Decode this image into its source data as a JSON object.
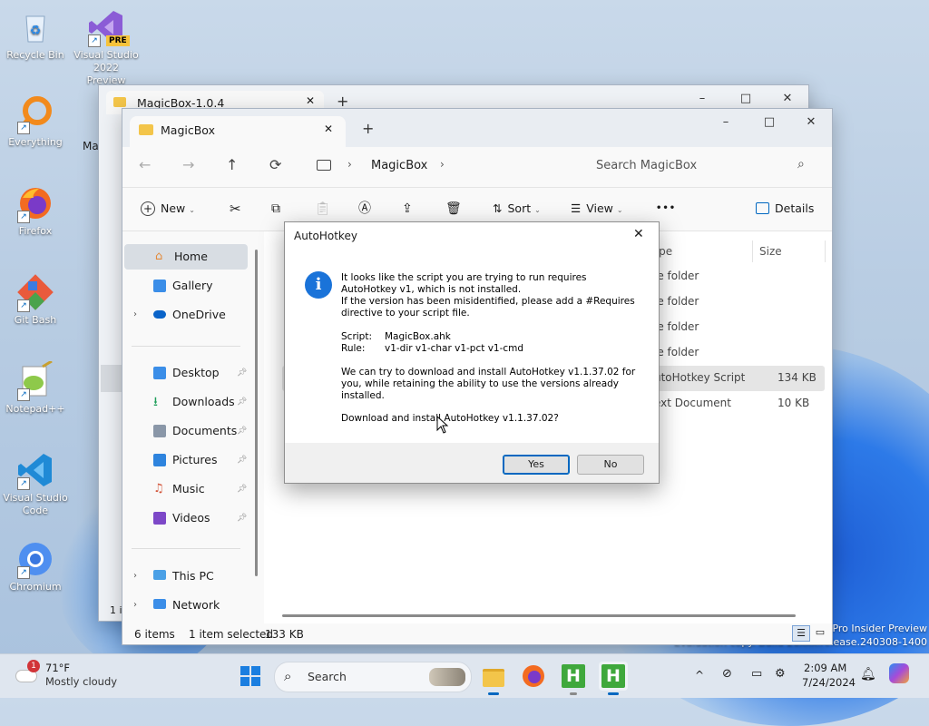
{
  "desktop": {
    "icons": [
      {
        "label": "Recycle Bin"
      },
      {
        "label": "Visual Studio 2022 Preview",
        "badge": "PRE"
      },
      {
        "label": "Everything"
      },
      {
        "label": "Firefox"
      },
      {
        "label": "Git Bash"
      },
      {
        "label": "Notepad++"
      },
      {
        "label": "Visual Studio Code"
      },
      {
        "label": "Chromium"
      }
    ],
    "watermark": [
      "Pro Insider Preview",
      "Evaluation copy. Build 26xxx.release.240308-1400"
    ]
  },
  "back_window": {
    "tab_title": "MagicBox-1.0.4",
    "partial_labels": [
      "Ma",
      "1 i"
    ]
  },
  "explorer": {
    "tab_title": "MagicBox",
    "new_tab": "+",
    "controls": {
      "minimize": "–",
      "maximize": "□",
      "close": "✕"
    },
    "breadcrumb": "MagicBox",
    "search_placeholder": "Search MagicBox",
    "toolbar": {
      "new": "New",
      "sort": "Sort",
      "view": "View",
      "more": "•••",
      "details": "Details"
    },
    "nav": [
      {
        "label": "Home",
        "selected": true
      },
      {
        "label": "Gallery"
      },
      {
        "label": "OneDrive",
        "expandable": true
      },
      {
        "label": "Desktop",
        "pinned": true
      },
      {
        "label": "Downloads",
        "pinned": true
      },
      {
        "label": "Documents",
        "pinned": true
      },
      {
        "label": "Pictures",
        "pinned": true
      },
      {
        "label": "Music",
        "pinned": true
      },
      {
        "label": "Videos",
        "pinned": true
      },
      {
        "label": "This PC",
        "expandable": true
      },
      {
        "label": "Network",
        "expandable": true
      }
    ],
    "columns": {
      "type": "ype",
      "size": "Size"
    },
    "files": [
      {
        "type": "le folder",
        "size": ""
      },
      {
        "type": "le folder",
        "size": ""
      },
      {
        "type": "le folder",
        "size": ""
      },
      {
        "type": "le folder",
        "size": ""
      },
      {
        "type": "utoHotkey Script",
        "size": "134 KB",
        "selected": true
      },
      {
        "type": "ext Document",
        "size": "10 KB"
      }
    ],
    "status": {
      "items": "6 items",
      "selected": "1 item selected",
      "size": "133 KB"
    }
  },
  "dialog": {
    "title": "AutoHotkey",
    "close": "✕",
    "info_glyph": "i",
    "line1": "It looks like the script you are trying to run requires",
    "line2": "AutoHotkey v1, which is not installed.",
    "line3": "If the version has been misidentified, please add a #Requires",
    "line4": "directive to your script file.",
    "script_label": "Script:",
    "script_value": "MagicBox.ahk",
    "rule_label": "Rule:",
    "rule_value": "v1-dir v1-char v1-pct v1-cmd",
    "line5": "We can try to download and install AutoHotkey v1.1.37.02 for",
    "line6": "you, while retaining the ability to use the versions already",
    "line7": "installed.",
    "question": "Download and install AutoHotkey v1.1.37.02?",
    "yes": "Yes",
    "no": "No"
  },
  "taskbar": {
    "weather_temp": "71°F",
    "weather_desc": "Mostly cloudy",
    "weather_badge": "1",
    "search_label": "Search",
    "time": "2:09 AM",
    "date": "7/24/2024",
    "tray_chevron": "^"
  },
  "colors": {
    "accent": "#0067c0",
    "info_blue": "#1a73d9",
    "folder": "#f3c54a"
  }
}
